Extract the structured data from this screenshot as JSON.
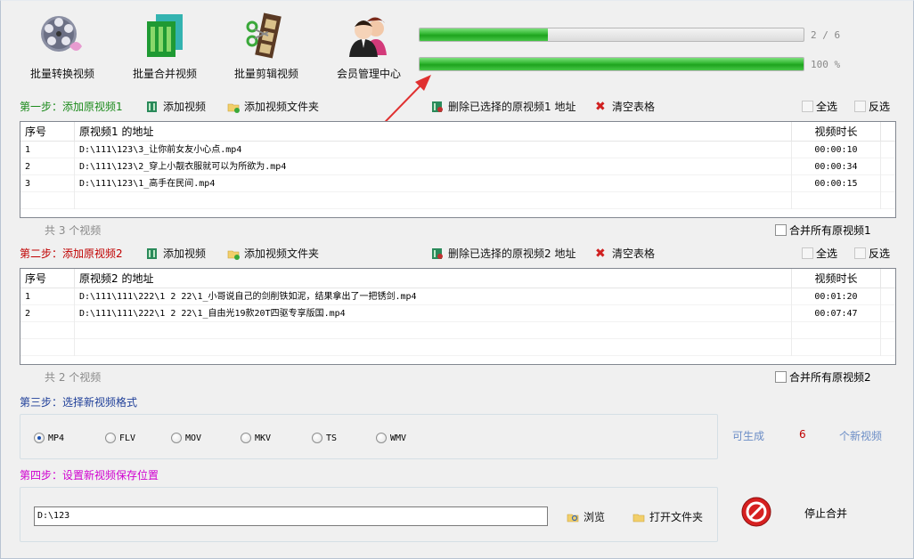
{
  "toolbar": {
    "batch_convert": "批量转换视频",
    "batch_merge": "批量合并视频",
    "batch_edit": "批量剪辑视频",
    "member_center": "会员管理中心"
  },
  "progress": {
    "overall_text": "2 / 6",
    "overall_fraction": 0.3333,
    "current_text": "100 %",
    "current_fraction": 1.0
  },
  "step1": {
    "title": "第一步：添加原视频1",
    "add_video": "添加视频",
    "add_folder": "添加视频文件夹",
    "delete_selected": "删除已选择的原视频1 地址",
    "clear_table": "清空表格",
    "select_all": "全选",
    "invert": "反选",
    "columns": [
      "序号",
      "原视频1 的地址",
      "视频时长"
    ],
    "rows": [
      {
        "no": "1",
        "path": "D:\\111\\123\\3_让你前女友小心点.mp4",
        "duration": "00:00:10"
      },
      {
        "no": "2",
        "path": "D:\\111\\123\\2_穿上小靓衣服就可以为所欲为.mp4",
        "duration": "00:00:34"
      },
      {
        "no": "3",
        "path": "D:\\111\\123\\1_高手在民间.mp4",
        "duration": "00:00:15"
      }
    ],
    "count": "共 3 个视频",
    "merge_all": "合并所有原视频1"
  },
  "step2": {
    "title": "第二步：添加原视频2",
    "add_video": "添加视频",
    "add_folder": "添加视频文件夹",
    "delete_selected": "删除已选择的原视频2 地址",
    "clear_table": "清空表格",
    "select_all": "全选",
    "invert": "反选",
    "columns": [
      "序号",
      "原视频2 的地址",
      "视频时长"
    ],
    "rows": [
      {
        "no": "1",
        "path": "D:\\111\\111\\222\\1 2  22\\1_小哥说自己的剑削铁如泥，结果拿出了一把锈剑.mp4",
        "duration": "00:01:20"
      },
      {
        "no": "2",
        "path": "D:\\111\\111\\222\\1 2  22\\1_自由光19款20T四驱专享版国.mp4",
        "duration": "00:07:47"
      }
    ],
    "count": "共 2 个视频",
    "merge_all": "合并所有原视频2"
  },
  "step3": {
    "title": "第三步：选择新视频格式",
    "formats": [
      "MP4",
      "FLV",
      "MOV",
      "MKV",
      "TS",
      "WMV"
    ],
    "selected": "MP4",
    "gen_prefix": "可生成",
    "gen_count": "6",
    "gen_suffix": "个新视频"
  },
  "step4": {
    "title": "第四步：设置新视频保存位置",
    "path_value": "D:\\123",
    "browse": "浏览",
    "open_folder": "打开文件夹",
    "stop": "停止合并"
  },
  "colors": {
    "step1": "#1a8a1a",
    "step2": "#c00000",
    "step3": "#1f3f99",
    "step4": "#d000d0",
    "gen_text": "#6b8dc6",
    "gen_count": "#c00000"
  }
}
